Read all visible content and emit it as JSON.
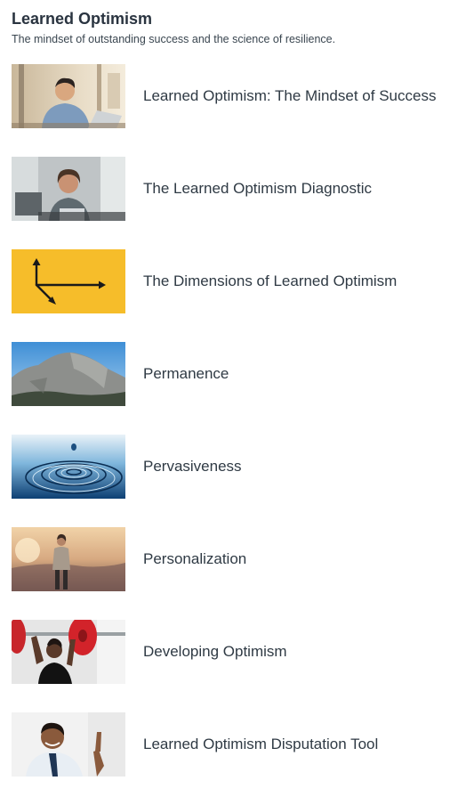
{
  "header": {
    "title": "Learned Optimism",
    "subtitle": "The mindset of outstanding success and the science of resilience."
  },
  "lessons": [
    {
      "title": "Learned Optimism: The Mindset of Success",
      "icon": "businessman-laptop-photo"
    },
    {
      "title": "The Learned Optimism Diagnostic",
      "icon": "woman-office-photo"
    },
    {
      "title": "The Dimensions of Learned Optimism",
      "icon": "axes-arrows-icon"
    },
    {
      "title": "Permanence",
      "icon": "mountain-photo"
    },
    {
      "title": "Pervasiveness",
      "icon": "water-ripple-photo"
    },
    {
      "title": "Personalization",
      "icon": "woman-sunset-photo"
    },
    {
      "title": "Developing Optimism",
      "icon": "weightlifter-photo"
    },
    {
      "title": "Learned Optimism Disputation Tool",
      "icon": "man-pointing-photo"
    }
  ],
  "colors": {
    "axes_background": "#f6bd2a",
    "text": "#2f3a44"
  }
}
